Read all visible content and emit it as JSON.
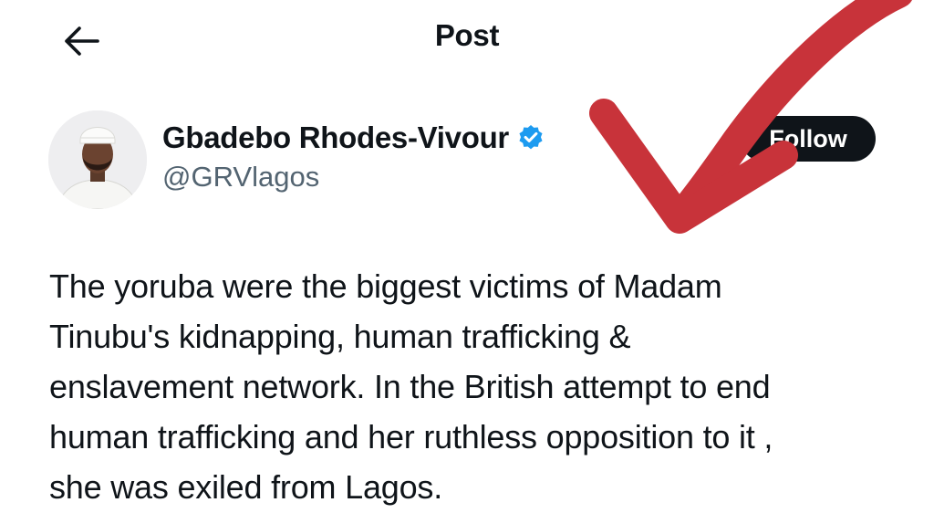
{
  "header": {
    "title": "Post",
    "back_icon": "arrow-left-icon",
    "more_icon": "more-dots-icon"
  },
  "author": {
    "name": "Gbadebo Rhodes-Vivour",
    "handle": "@GRVlagos",
    "verified": true,
    "verified_color": "#1d9bf0",
    "follow_label": "Follow"
  },
  "post": {
    "lines": [
      "The yoruba were the biggest victims of Madam",
      "Tinubu's kidnapping, human trafficking &",
      "enslavement network. In the British attempt to end",
      "human trafficking and her ruthless opposition to it ,",
      "she was exiled from Lagos."
    ]
  },
  "overlay": {
    "arrow_color": "#c8333a"
  }
}
